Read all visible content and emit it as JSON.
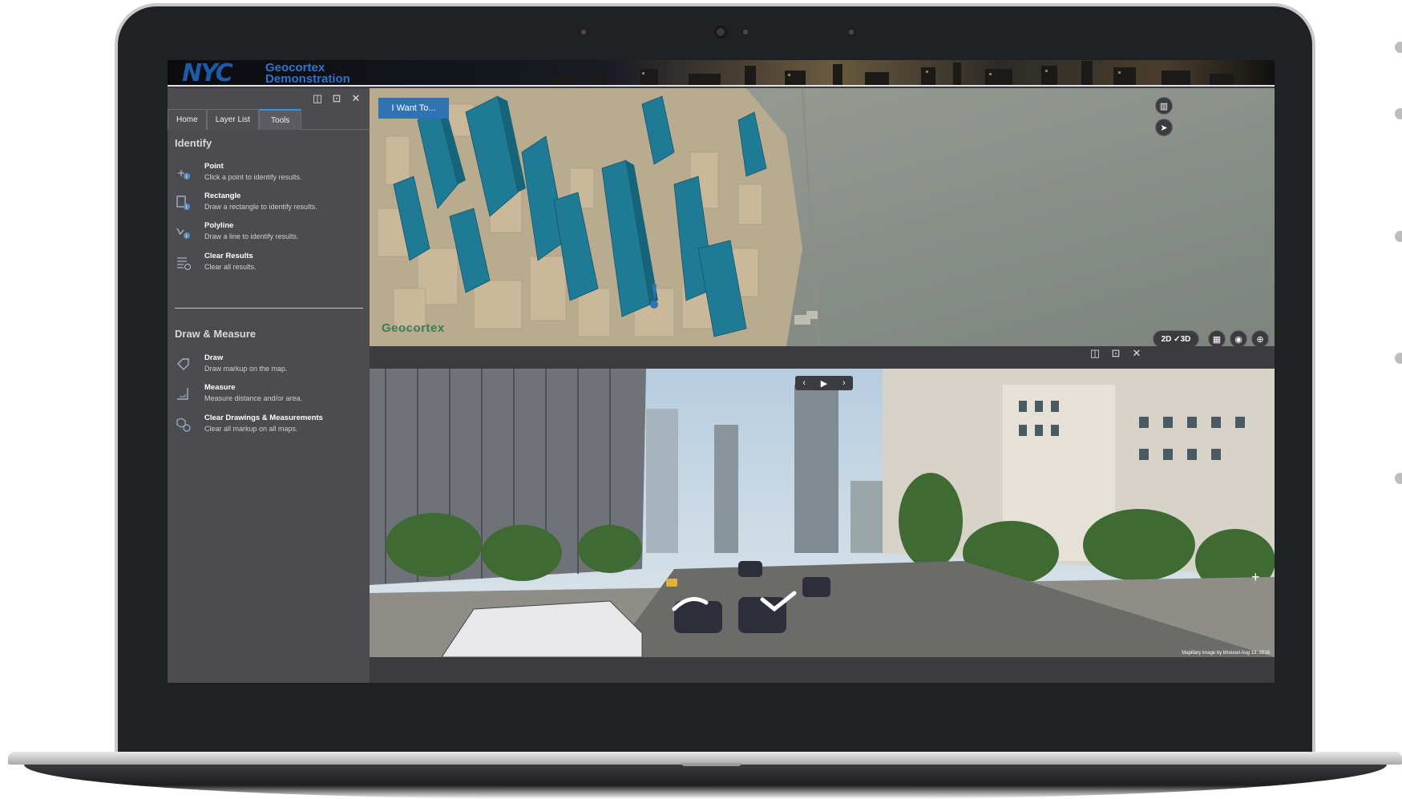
{
  "header": {
    "logo_text": "NYC",
    "title_line1": "Geocortex",
    "title_line2": "Demonstration"
  },
  "panel": {
    "tabs": [
      {
        "label": "Home"
      },
      {
        "label": "Layer List"
      },
      {
        "label": "Tools"
      }
    ],
    "active_tab": "Tools",
    "identify": {
      "title": "Identify",
      "tools": [
        {
          "name": "Point",
          "desc": "Click a point to identify results.",
          "icon": "point-identify-icon"
        },
        {
          "name": "Rectangle",
          "desc": "Draw a rectangle to identify results.",
          "icon": "rectangle-identify-icon"
        },
        {
          "name": "Polyline",
          "desc": "Draw a line to identify results.",
          "icon": "polyline-identify-icon"
        },
        {
          "name": "Clear Results",
          "desc": "Clear all results.",
          "icon": "clear-results-icon"
        }
      ]
    },
    "draw_measure": {
      "title": "Draw & Measure",
      "tools": [
        {
          "name": "Draw",
          "desc": "Draw markup on the map.",
          "icon": "draw-icon"
        },
        {
          "name": "Measure",
          "desc": "Measure distance and/or area.",
          "icon": "measure-icon"
        },
        {
          "name": "Clear Drawings & Measurements",
          "desc": "Clear all markup on all maps.",
          "icon": "clear-drawings-icon"
        }
      ]
    }
  },
  "map": {
    "i_want_to": "I Want To...",
    "watermark": "Geocortex",
    "dimension_toggle": "2D ✓3D"
  },
  "streetview": {
    "attribution": "Mapillary   image by bhousel  Aug 13, 2016"
  },
  "colors": {
    "accent": "#2f73b5",
    "panel_bg": "#4b4b50",
    "building_highlight": "#1f7a95"
  }
}
